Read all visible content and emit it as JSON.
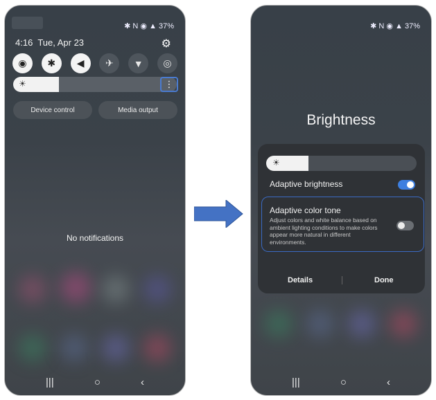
{
  "left_phone": {
    "status": {
      "icons": "✱ N ◉ ▲",
      "battery": "37%"
    },
    "time": "4:16",
    "date": "Tue, Apr 23",
    "quick_settings": [
      {
        "icon": "wifi-icon",
        "glyph": "◉",
        "on": true
      },
      {
        "icon": "bluetooth-icon",
        "glyph": "✱",
        "on": true
      },
      {
        "icon": "sound-icon",
        "glyph": "◀",
        "on": true
      },
      {
        "icon": "airplane-icon",
        "glyph": "✈",
        "on": false
      },
      {
        "icon": "flashlight-icon",
        "glyph": "▼",
        "on": false
      },
      {
        "icon": "power-saving-icon",
        "glyph": "◎",
        "on": false
      }
    ],
    "brightness_level": 0.28,
    "buttons": {
      "device_control": "Device control",
      "media_output": "Media output"
    },
    "no_notifications": "No notifications"
  },
  "right_phone": {
    "status": {
      "icons": "✱ N ◉ ▲",
      "battery": "37%"
    },
    "title": "Brightness",
    "brightness_level": 0.28,
    "adaptive_brightness": {
      "label": "Adaptive brightness",
      "enabled": true
    },
    "adaptive_color_tone": {
      "label": "Adaptive color tone",
      "description": "Adjust colors and white balance based on ambient lighting conditions to make colors appear more natural in different environments.",
      "enabled": false
    },
    "actions": {
      "details": "Details",
      "done": "Done"
    }
  },
  "nav": {
    "recents": "|||",
    "home": "○",
    "back": "‹"
  },
  "colors": {
    "accent": "#3d7fe0",
    "arrow": "#4472c4",
    "highlight": "#3b6bc4"
  }
}
